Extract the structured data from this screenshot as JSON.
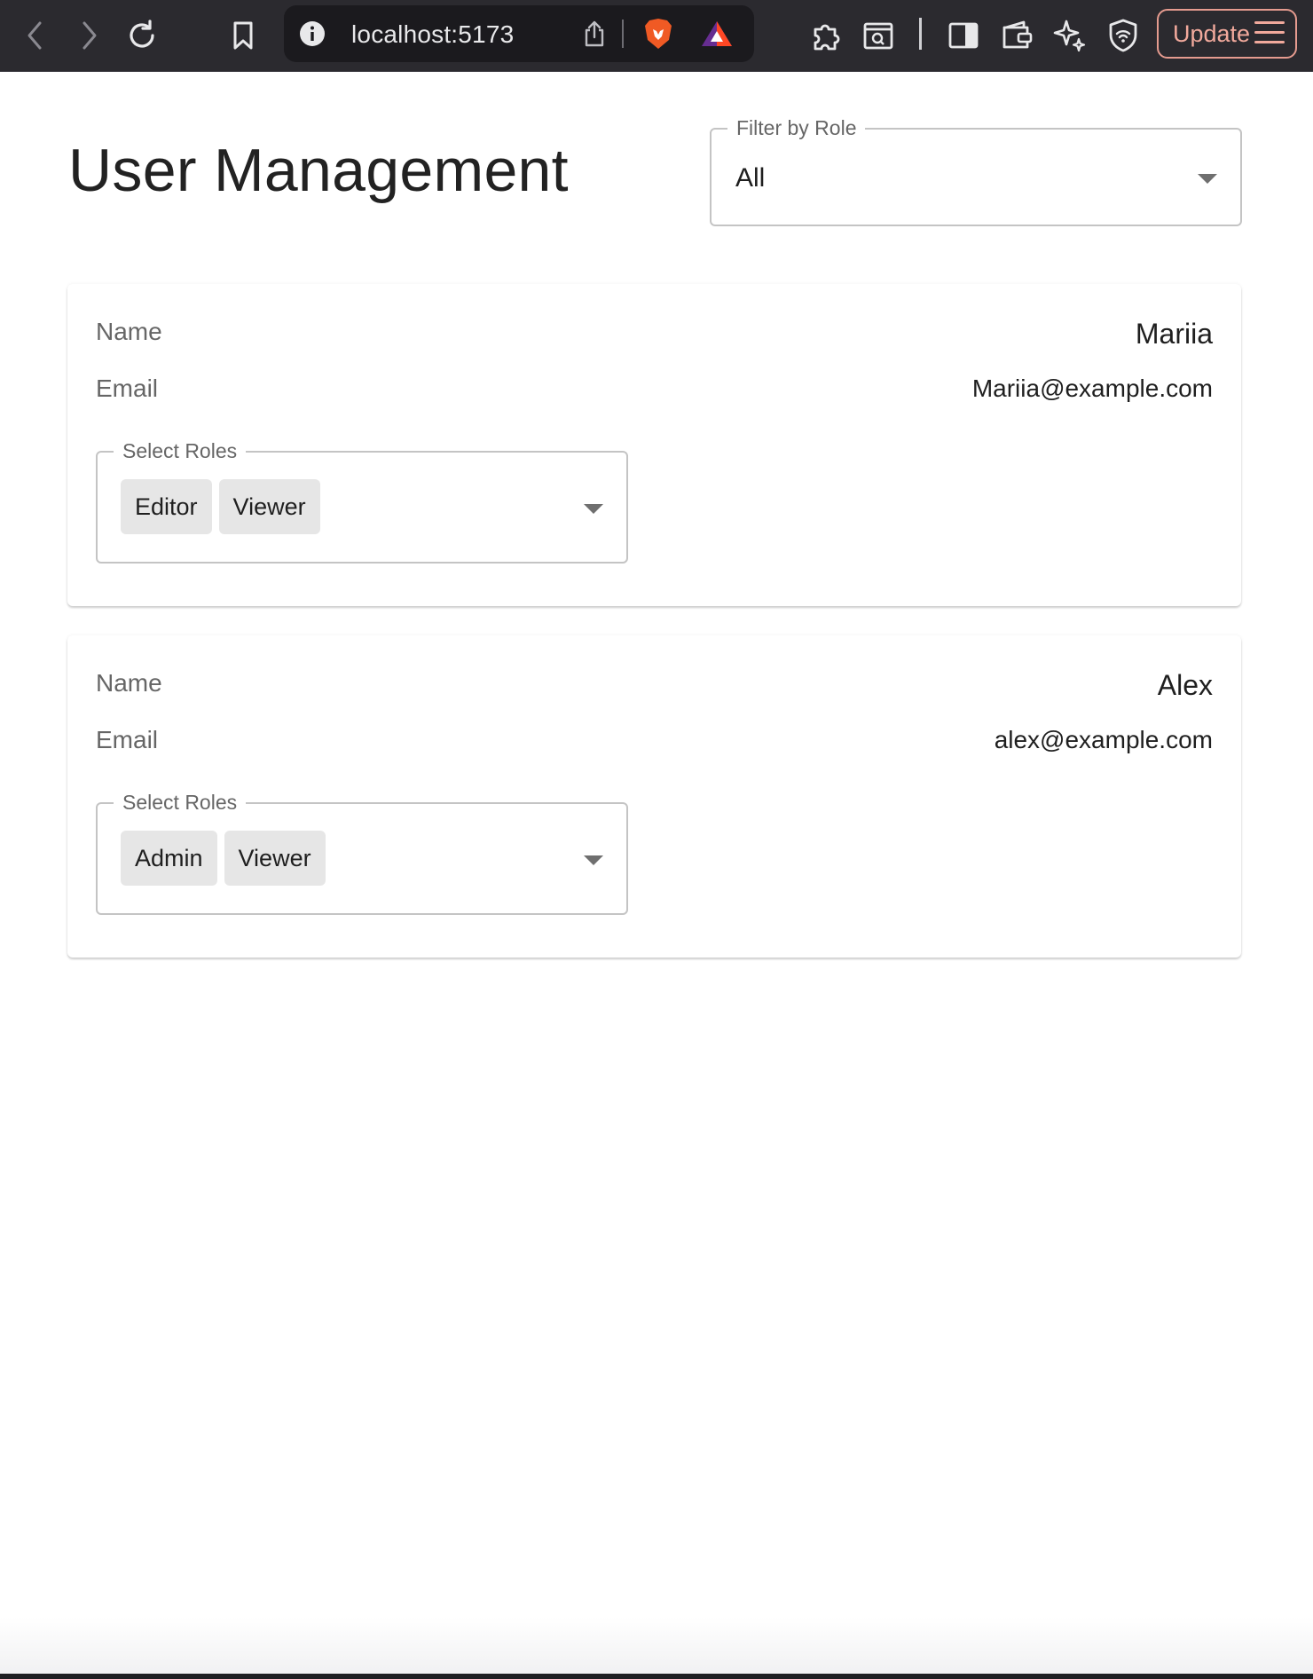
{
  "browser": {
    "url": "localhost:5173",
    "update_label": "Update"
  },
  "page": {
    "title": "User Management",
    "filter": {
      "label": "Filter by Role",
      "value": "All"
    }
  },
  "users": [
    {
      "name_label": "Name",
      "name": "Mariia",
      "email_label": "Email",
      "email": "Mariia@example.com",
      "roles_label": "Select Roles",
      "roles": [
        "Editor",
        "Viewer"
      ]
    },
    {
      "name_label": "Name",
      "name": "Alex",
      "email_label": "Email",
      "email": "alex@example.com",
      "roles_label": "Select Roles",
      "roles": [
        "Admin",
        "Viewer"
      ]
    }
  ],
  "colors": {
    "toolbar_bg": "#2b2a2f",
    "update_accent": "#f1a99c",
    "outline": "#c4c4c4",
    "chip_bg": "#e6e6e6"
  }
}
